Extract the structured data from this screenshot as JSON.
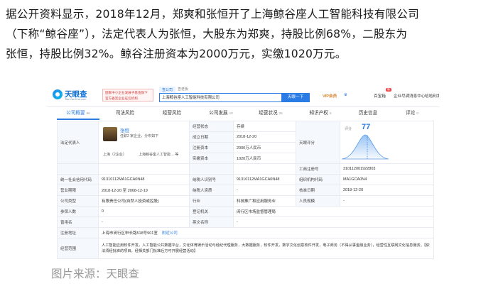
{
  "article": {
    "lines": [
      "据公开资料显示，2018年12月，郑爽和张恒开了上海鲸谷座人工智能科技有限公司",
      "（下称“鲸谷座”），法定代表人为张恒，大股东为郑爽，持股比例68%，二股东为",
      "张恒，持股比例32%。鲸谷注册资本为2000万元，实缴1020万元。"
    ]
  },
  "screenshot": {
    "logo": {
      "name": "天眼查",
      "sub": "TianYanCha.com"
    },
    "gov_badge": "国家中小企业发展子基金旗下 官方备案企业征信机构",
    "search": {
      "tab_active": "查公司",
      "tab_other": "查老板",
      "value": "上海鲸谷座人工智能科技有限公司",
      "button": "天眼一下"
    },
    "nav": {
      "vip": "VIP会员",
      "app": "百宝箱",
      "new_badge": "新",
      "diligence": "企业尽调",
      "news": "消息中心",
      "user": "哈哈利发"
    },
    "tabs": [
      {
        "label": "公司概要",
        "count": "96",
        "active": true
      },
      {
        "label": "司法风险",
        "count": "",
        "active": false
      },
      {
        "label": "经营风险",
        "count": "",
        "active": false
      },
      {
        "label": "公司发展",
        "count": "10",
        "active": false
      },
      {
        "label": "经营状况",
        "count": "25",
        "active": false
      },
      {
        "label": "知识产权",
        "count": "6",
        "active": false
      },
      {
        "label": "历史信息",
        "count": "",
        "active": false
      },
      {
        "label": "评论",
        "count": "0",
        "active": false
      }
    ],
    "legal_rep": {
      "label": "法定代表人",
      "name": "张恒",
      "meta": "任职2 家企业，分布如下",
      "location": "上海（2企业）",
      "company": "上海鲸谷座人工智能… 等"
    },
    "basic": {
      "status_label": "经营状态",
      "status": "存续",
      "founded_label": "成立日期",
      "founded": "2018-12-20",
      "capital_label": "注册资本",
      "capital": "2000万人民币",
      "paid_label": "实缴资本",
      "paid": "1020万人民币"
    },
    "score": {
      "label": "天眼评分",
      "title": "评分",
      "value": "77"
    },
    "reg_no": {
      "label": "工商注册号",
      "value": "310112001922803"
    },
    "rows": {
      "credit_label": "统一社会信用代码",
      "credit": "91310112MA1GCA0N48",
      "taxid_label": "纳税人识别号",
      "taxid": "91310112MA1GCA0N48",
      "org_label": "组织机构代码",
      "org": "MA1GCA0N4",
      "term_label": "营业期限",
      "term": "2018-12-20  至  2068-12-19",
      "taxpayer_label": "纳税人资质",
      "taxpayer": "-",
      "approve_label": "核准日期",
      "approve": "2018-12-20",
      "type_label": "公司类型",
      "type": "有限责任公司(自然人投资或控股)",
      "industry_label": "行业",
      "industry": "科技推广和应用服务业",
      "size_label": "人员规模",
      "size": "-",
      "insured_label": "参保人数",
      "insured": "0",
      "authority_label": "登记机关",
      "authority": "闵行区市场监督管理局",
      "former_label": "曾用名",
      "former": "-",
      "english_label": "英文名称",
      "english": "-",
      "address_label": "注册地址",
      "address": "上海市闵行区申长路518号901室",
      "address_link": "附近公司",
      "scope_label": "经营范围",
      "scope": "人工智能应用软件开发，人工智能公共数据平台，文化体育娱乐活动与经纪代理服务，大数据服务，软件开发，数字文化创意软件开发，电子商务（不得从事金融业务），经营性互联网文化信息服务。【依法须经批准的项目，经相关部门批准后方可开展经营活动】"
    },
    "colors": {
      "brand": "#2b7be4",
      "vip": "#d9822b",
      "badge": "#f04a4a"
    }
  },
  "caption": "图片来源：天眼查"
}
